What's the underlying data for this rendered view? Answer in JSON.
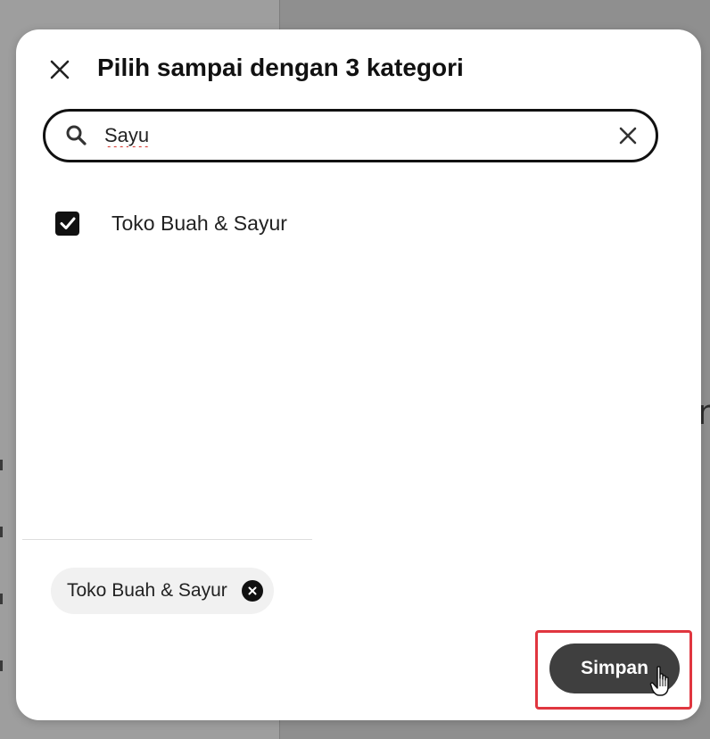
{
  "backdrop": {
    "glyph": "n"
  },
  "modal": {
    "title": "Pilih sampai dengan 3 kategori",
    "close_icon": "close-icon"
  },
  "search": {
    "icon": "search-icon",
    "value": "Sayu",
    "placeholder": "",
    "clear_icon": "close-icon"
  },
  "results": [
    {
      "label": "Toko Buah & Sayur",
      "checked": true
    }
  ],
  "selected_chips": [
    {
      "label": "Toko Buah & Sayur",
      "remove_icon": "close-circle-icon"
    }
  ],
  "actions": {
    "save_label": "Simpan"
  },
  "colors": {
    "overlay": "#8f8f8f",
    "primary_button": "#3f3f3f",
    "highlight": "#e0363f",
    "checkbox": "#111111",
    "chip_bg": "#f1f1f1"
  }
}
